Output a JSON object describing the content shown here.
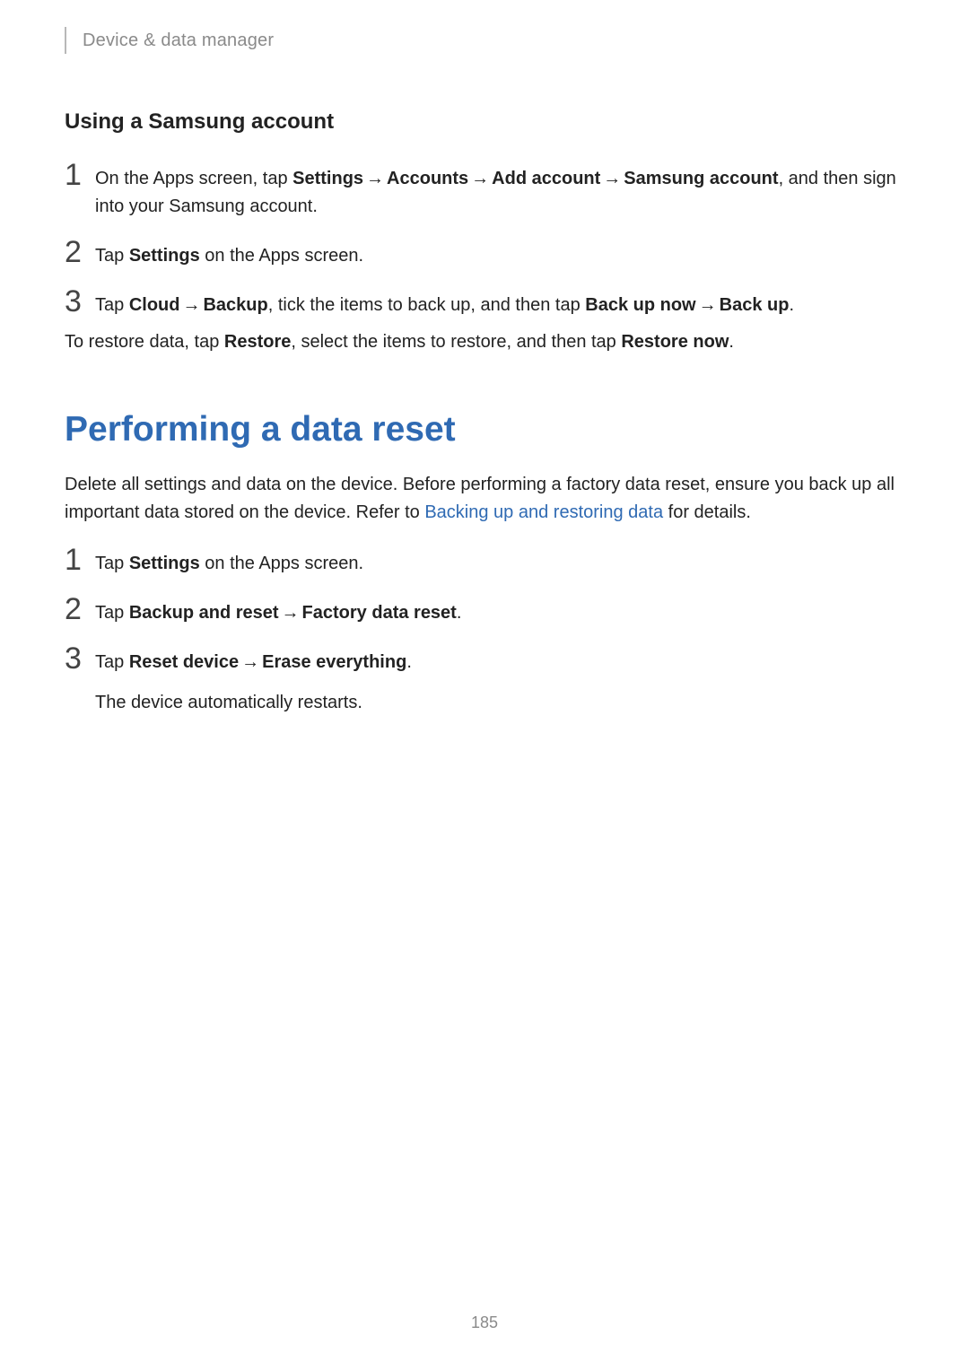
{
  "chapter": "Device & data manager",
  "section1": {
    "subheading": "Using a Samsung account",
    "step1": {
      "pre": "On the Apps screen, tap ",
      "b1": "Settings",
      "b2": "Accounts",
      "b3": "Add account",
      "b4": "Samsung account",
      "post": ", and then sign into your Samsung account."
    },
    "step2": {
      "pre": "Tap ",
      "b1": "Settings",
      "post": " on the Apps screen."
    },
    "step3": {
      "pre": "Tap ",
      "b1": "Cloud",
      "b2": "Backup",
      "mid": ", tick the items to back up, and then tap ",
      "b3": "Back up now",
      "b4": "Back up",
      "post": "."
    },
    "restore": {
      "pre": "To restore data, tap ",
      "b1": "Restore",
      "mid": ", select the items to restore, and then tap ",
      "b2": "Restore now",
      "post": "."
    }
  },
  "section2": {
    "title": "Performing a data reset",
    "intro": {
      "pre": "Delete all settings and data on the device. Before performing a factory data reset, ensure you back up all important data stored on the device. Refer to ",
      "link": "Backing up and restoring data",
      "post": " for details."
    },
    "step1": {
      "pre": "Tap ",
      "b1": "Settings",
      "post": " on the Apps screen."
    },
    "step2": {
      "pre": "Tap ",
      "b1": "Backup and reset",
      "b2": "Factory data reset",
      "post": "."
    },
    "step3": {
      "pre": "Tap ",
      "b1": "Reset device",
      "b2": "Erase everything",
      "post": ".",
      "tail": "The device automatically restarts."
    }
  },
  "arrow": "→",
  "pagenum": "185"
}
